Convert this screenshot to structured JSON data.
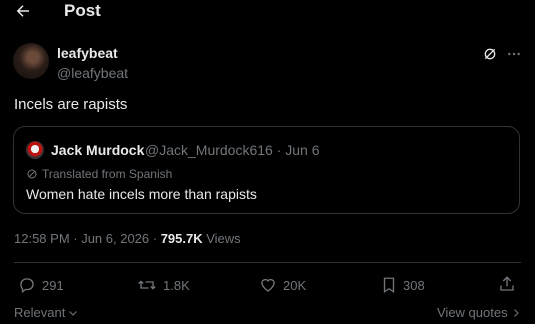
{
  "header": {
    "title": "Post",
    "back_icon": "arrow-left-icon"
  },
  "post": {
    "author": {
      "display_name": "leafybeat",
      "handle": "@leafybeat"
    },
    "text": "Incels are rapists",
    "quote": {
      "display_name": "Jack Murdock",
      "meta": "@Jack_Murdock616 · Jun 6",
      "translated_label": "Translated from Spanish",
      "text": "Women hate incels more than rapists"
    },
    "timestamp": "12:58 PM · Jun 6, 2026 · ",
    "views_count": "795.7K",
    "views_label": " Views"
  },
  "actions": {
    "replies": "291",
    "reposts": "1.8K",
    "likes": "20K",
    "bookmarks": "308"
  },
  "footer": {
    "relevant_label": "Relevant",
    "view_quotes_label": "View quotes"
  },
  "colors": {
    "background": "#000000",
    "text": "#e7e9ea",
    "muted": "#71767b",
    "border": "#2f3336"
  }
}
